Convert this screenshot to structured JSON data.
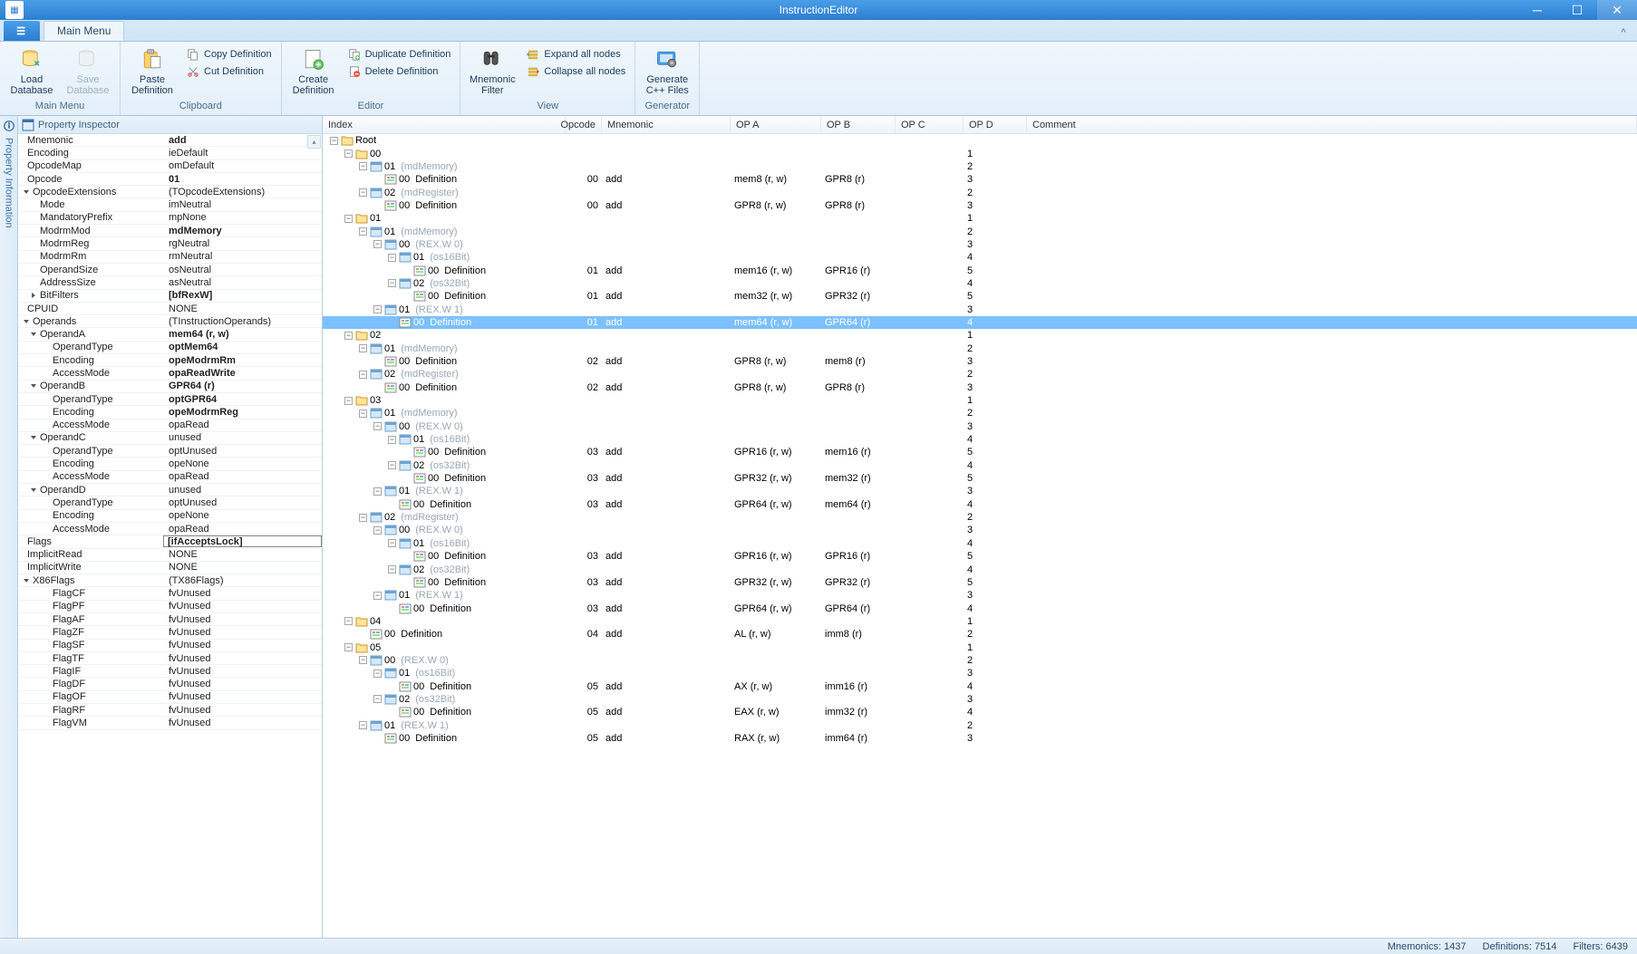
{
  "title": "InstructionEditor",
  "tab": "Main Menu",
  "ribbon": {
    "groups": [
      {
        "label": "Main Menu",
        "items": [
          {
            "kind": "big",
            "icon": "db-load",
            "label": "Load\nDatabase",
            "disabled": false
          },
          {
            "kind": "big",
            "icon": "db-save",
            "label": "Save\nDatabase",
            "disabled": true
          }
        ]
      },
      {
        "label": "Clipboard",
        "items": [
          {
            "kind": "big",
            "icon": "paste",
            "label": "Paste\nDefinition"
          },
          {
            "kind": "vlist",
            "sub": [
              {
                "icon": "copy",
                "label": "Copy Definition"
              },
              {
                "icon": "cut",
                "label": "Cut Definition"
              }
            ]
          }
        ]
      },
      {
        "label": "Editor",
        "items": [
          {
            "kind": "big",
            "icon": "create",
            "label": "Create\nDefinition"
          },
          {
            "kind": "vlist",
            "sub": [
              {
                "icon": "dup",
                "label": "Duplicate Definition"
              },
              {
                "icon": "del",
                "label": "Delete Definition"
              }
            ]
          }
        ]
      },
      {
        "label": "View",
        "items": [
          {
            "kind": "big",
            "icon": "filter",
            "label": "Mnemonic\nFilter"
          },
          {
            "kind": "vlist",
            "sub": [
              {
                "icon": "expand",
                "label": "Expand all nodes"
              },
              {
                "icon": "collapse",
                "label": "Collapse all nodes"
              }
            ]
          }
        ]
      },
      {
        "label": "Generator",
        "items": [
          {
            "kind": "big",
            "icon": "gen",
            "label": "Generate\nC++ Files"
          }
        ]
      }
    ]
  },
  "side_label": "Property Information",
  "prop_title": "Property Inspector",
  "props": [
    {
      "d": 0,
      "k": "Mnemonic",
      "v": "add",
      "b": 1
    },
    {
      "d": 0,
      "k": "Encoding",
      "v": "ieDefault"
    },
    {
      "d": 0,
      "k": "OpcodeMap",
      "v": "omDefault"
    },
    {
      "d": 0,
      "k": "Opcode",
      "v": "01",
      "b": 1
    },
    {
      "d": 0,
      "k": "OpcodeExtensions",
      "v": "(TOpcodeExtensions)",
      "ex": "▾"
    },
    {
      "d": 1,
      "k": "Mode",
      "v": "imNeutral"
    },
    {
      "d": 1,
      "k": "MandatoryPrefix",
      "v": "mpNone"
    },
    {
      "d": 1,
      "k": "ModrmMod",
      "v": "mdMemory",
      "b": 1
    },
    {
      "d": 1,
      "k": "ModrmReg",
      "v": "rgNeutral"
    },
    {
      "d": 1,
      "k": "ModrmRm",
      "v": "rmNeutral"
    },
    {
      "d": 1,
      "k": "OperandSize",
      "v": "osNeutral"
    },
    {
      "d": 1,
      "k": "AddressSize",
      "v": "asNeutral"
    },
    {
      "d": 1,
      "k": "BitFilters",
      "v": "[bfRexW]",
      "b": 1,
      "ex": "▸"
    },
    {
      "d": 0,
      "k": "CPUID",
      "v": "NONE"
    },
    {
      "d": 0,
      "k": "Operands",
      "v": "(TInstructionOperands)",
      "ex": "▾"
    },
    {
      "d": 1,
      "k": "OperandA",
      "v": "mem64 (r, w)",
      "b": 1,
      "ex": "▾"
    },
    {
      "d": 2,
      "k": "OperandType",
      "v": "optMem64",
      "b": 1
    },
    {
      "d": 2,
      "k": "Encoding",
      "v": "opeModrmRm",
      "b": 1
    },
    {
      "d": 2,
      "k": "AccessMode",
      "v": "opaReadWrite",
      "b": 1
    },
    {
      "d": 1,
      "k": "OperandB",
      "v": "GPR64 (r)",
      "b": 1,
      "ex": "▾"
    },
    {
      "d": 2,
      "k": "OperandType",
      "v": "optGPR64",
      "b": 1
    },
    {
      "d": 2,
      "k": "Encoding",
      "v": "opeModrmReg",
      "b": 1
    },
    {
      "d": 2,
      "k": "AccessMode",
      "v": "opaRead"
    },
    {
      "d": 1,
      "k": "OperandC",
      "v": "unused",
      "ex": "▾"
    },
    {
      "d": 2,
      "k": "OperandType",
      "v": "optUnused"
    },
    {
      "d": 2,
      "k": "Encoding",
      "v": "opeNone"
    },
    {
      "d": 2,
      "k": "AccessMode",
      "v": "opaRead"
    },
    {
      "d": 1,
      "k": "OperandD",
      "v": "unused",
      "ex": "▾"
    },
    {
      "d": 2,
      "k": "OperandType",
      "v": "optUnused"
    },
    {
      "d": 2,
      "k": "Encoding",
      "v": "opeNone"
    },
    {
      "d": 2,
      "k": "AccessMode",
      "v": "opaRead"
    },
    {
      "d": 0,
      "k": "Flags",
      "v": "[ifAcceptsLock]",
      "b": 1,
      "sel": 1
    },
    {
      "d": 0,
      "k": "ImplicitRead",
      "v": "NONE"
    },
    {
      "d": 0,
      "k": "ImplicitWrite",
      "v": "NONE"
    },
    {
      "d": 0,
      "k": "X86Flags",
      "v": "(TX86Flags)",
      "ex": "▾"
    },
    {
      "d": 2,
      "k": "FlagCF",
      "v": "fvUnused"
    },
    {
      "d": 2,
      "k": "FlagPF",
      "v": "fvUnused"
    },
    {
      "d": 2,
      "k": "FlagAF",
      "v": "fvUnused"
    },
    {
      "d": 2,
      "k": "FlagZF",
      "v": "fvUnused"
    },
    {
      "d": 2,
      "k": "FlagSF",
      "v": "fvUnused"
    },
    {
      "d": 2,
      "k": "FlagTF",
      "v": "fvUnused"
    },
    {
      "d": 2,
      "k": "FlagIF",
      "v": "fvUnused"
    },
    {
      "d": 2,
      "k": "FlagDF",
      "v": "fvUnused"
    },
    {
      "d": 2,
      "k": "FlagOF",
      "v": "fvUnused"
    },
    {
      "d": 2,
      "k": "FlagRF",
      "v": "fvUnused"
    },
    {
      "d": 2,
      "k": "FlagVM",
      "v": "fvUnused"
    }
  ],
  "cols": {
    "index": "Index",
    "opcode": "Opcode",
    "mnemonic": "Mnemonic",
    "opa": "OP A",
    "opb": "OP B",
    "opc": "OP C",
    "opd": "OP D",
    "comment": "Comment"
  },
  "rows": [
    {
      "d": 0,
      "ex": "-",
      "ic": "f",
      "idx": "Root"
    },
    {
      "d": 1,
      "ex": "-",
      "ic": "f",
      "idx": "00"
    },
    {
      "d": 2,
      "ex": "-",
      "ic": "g",
      "idx": "01",
      "dim": "(mdMemory)"
    },
    {
      "d": 3,
      "ic": "d",
      "idx": "00",
      "txt": "Definition",
      "op": "00",
      "mn": "add",
      "a": "mem8 (r, w)",
      "b": "GPR8 (r)"
    },
    {
      "d": 2,
      "ex": "-",
      "ic": "g",
      "idx": "02",
      "dim": "(mdRegister)"
    },
    {
      "d": 3,
      "ic": "d",
      "idx": "00",
      "txt": "Definition",
      "op": "00",
      "mn": "add",
      "a": "GPR8 (r, w)",
      "b": "GPR8 (r)"
    },
    {
      "d": 1,
      "ex": "-",
      "ic": "f",
      "idx": "01"
    },
    {
      "d": 2,
      "ex": "-",
      "ic": "g",
      "idx": "01",
      "dim": "(mdMemory)"
    },
    {
      "d": 3,
      "ex": "-",
      "ic": "g",
      "idx": "00",
      "dim": "(REX.W 0)"
    },
    {
      "d": 4,
      "ex": "-",
      "ic": "g",
      "idx": "01",
      "dim": "(os16Bit)"
    },
    {
      "d": 5,
      "ic": "d",
      "idx": "00",
      "txt": "Definition",
      "op": "01",
      "mn": "add",
      "a": "mem16 (r, w)",
      "b": "GPR16 (r)"
    },
    {
      "d": 4,
      "ex": "-",
      "ic": "g",
      "idx": "02",
      "dim": "(os32Bit)"
    },
    {
      "d": 5,
      "ic": "d",
      "idx": "00",
      "txt": "Definition",
      "op": "01",
      "mn": "add",
      "a": "mem32 (r, w)",
      "b": "GPR32 (r)"
    },
    {
      "d": 3,
      "ex": "-",
      "ic": "g",
      "idx": "01",
      "dim": "(REX.W 1)"
    },
    {
      "d": 4,
      "ic": "d",
      "idx": "00",
      "txt": "Definition",
      "op": "01",
      "mn": "add",
      "a": "mem64 (r, w)",
      "b": "GPR64 (r)",
      "sel": 1
    },
    {
      "d": 1,
      "ex": "-",
      "ic": "f",
      "idx": "02"
    },
    {
      "d": 2,
      "ex": "-",
      "ic": "g",
      "idx": "01",
      "dim": "(mdMemory)"
    },
    {
      "d": 3,
      "ic": "d",
      "idx": "00",
      "txt": "Definition",
      "op": "02",
      "mn": "add",
      "a": "GPR8 (r, w)",
      "b": "mem8 (r)"
    },
    {
      "d": 2,
      "ex": "-",
      "ic": "g",
      "idx": "02",
      "dim": "(mdRegister)"
    },
    {
      "d": 3,
      "ic": "d",
      "idx": "00",
      "txt": "Definition",
      "op": "02",
      "mn": "add",
      "a": "GPR8 (r, w)",
      "b": "GPR8 (r)"
    },
    {
      "d": 1,
      "ex": "-",
      "ic": "f",
      "idx": "03"
    },
    {
      "d": 2,
      "ex": "-",
      "ic": "g",
      "idx": "01",
      "dim": "(mdMemory)"
    },
    {
      "d": 3,
      "ex": "-",
      "ic": "g",
      "idx": "00",
      "dim": "(REX.W 0)"
    },
    {
      "d": 4,
      "ex": "-",
      "ic": "g",
      "idx": "01",
      "dim": "(os16Bit)"
    },
    {
      "d": 5,
      "ic": "d",
      "idx": "00",
      "txt": "Definition",
      "op": "03",
      "mn": "add",
      "a": "GPR16 (r, w)",
      "b": "mem16 (r)"
    },
    {
      "d": 4,
      "ex": "-",
      "ic": "g",
      "idx": "02",
      "dim": "(os32Bit)"
    },
    {
      "d": 5,
      "ic": "d",
      "idx": "00",
      "txt": "Definition",
      "op": "03",
      "mn": "add",
      "a": "GPR32 (r, w)",
      "b": "mem32 (r)"
    },
    {
      "d": 3,
      "ex": "-",
      "ic": "g",
      "idx": "01",
      "dim": "(REX.W 1)"
    },
    {
      "d": 4,
      "ic": "d",
      "idx": "00",
      "txt": "Definition",
      "op": "03",
      "mn": "add",
      "a": "GPR64 (r, w)",
      "b": "mem64 (r)"
    },
    {
      "d": 2,
      "ex": "-",
      "ic": "g",
      "idx": "02",
      "dim": "(mdRegister)"
    },
    {
      "d": 3,
      "ex": "-",
      "ic": "g",
      "idx": "00",
      "dim": "(REX.W 0)"
    },
    {
      "d": 4,
      "ex": "-",
      "ic": "g",
      "idx": "01",
      "dim": "(os16Bit)"
    },
    {
      "d": 5,
      "ic": "d",
      "idx": "00",
      "txt": "Definition",
      "op": "03",
      "mn": "add",
      "a": "GPR16 (r, w)",
      "b": "GPR16 (r)"
    },
    {
      "d": 4,
      "ex": "-",
      "ic": "g",
      "idx": "02",
      "dim": "(os32Bit)"
    },
    {
      "d": 5,
      "ic": "d",
      "idx": "00",
      "txt": "Definition",
      "op": "03",
      "mn": "add",
      "a": "GPR32 (r, w)",
      "b": "GPR32 (r)"
    },
    {
      "d": 3,
      "ex": "-",
      "ic": "g",
      "idx": "01",
      "dim": "(REX.W 1)"
    },
    {
      "d": 4,
      "ic": "d",
      "idx": "00",
      "txt": "Definition",
      "op": "03",
      "mn": "add",
      "a": "GPR64 (r, w)",
      "b": "GPR64 (r)"
    },
    {
      "d": 1,
      "ex": "-",
      "ic": "f",
      "idx": "04"
    },
    {
      "d": 2,
      "ic": "d",
      "idx": "00",
      "txt": "Definition",
      "op": "04",
      "mn": "add",
      "a": "AL (r, w)",
      "b": "imm8 (r)"
    },
    {
      "d": 1,
      "ex": "-",
      "ic": "f",
      "idx": "05"
    },
    {
      "d": 2,
      "ex": "-",
      "ic": "g",
      "idx": "00",
      "dim": "(REX.W 0)"
    },
    {
      "d": 3,
      "ex": "-",
      "ic": "g",
      "idx": "01",
      "dim": "(os16Bit)"
    },
    {
      "d": 4,
      "ic": "d",
      "idx": "00",
      "txt": "Definition",
      "op": "05",
      "mn": "add",
      "a": "AX (r, w)",
      "b": "imm16 (r)"
    },
    {
      "d": 3,
      "ex": "-",
      "ic": "g",
      "idx": "02",
      "dim": "(os32Bit)"
    },
    {
      "d": 4,
      "ic": "d",
      "idx": "00",
      "txt": "Definition",
      "op": "05",
      "mn": "add",
      "a": "EAX (r, w)",
      "b": "imm32 (r)"
    },
    {
      "d": 2,
      "ex": "-",
      "ic": "g",
      "idx": "01",
      "dim": "(REX.W 1)"
    },
    {
      "d": 3,
      "ic": "d",
      "idx": "00",
      "txt": "Definition",
      "op": "05",
      "mn": "add",
      "a": "RAX (r, w)",
      "b": "imm64 (r)"
    }
  ],
  "status": {
    "mnemonics": "Mnemonics: 1437",
    "definitions": "Definitions: 7514",
    "filters": "Filters: 6439"
  }
}
